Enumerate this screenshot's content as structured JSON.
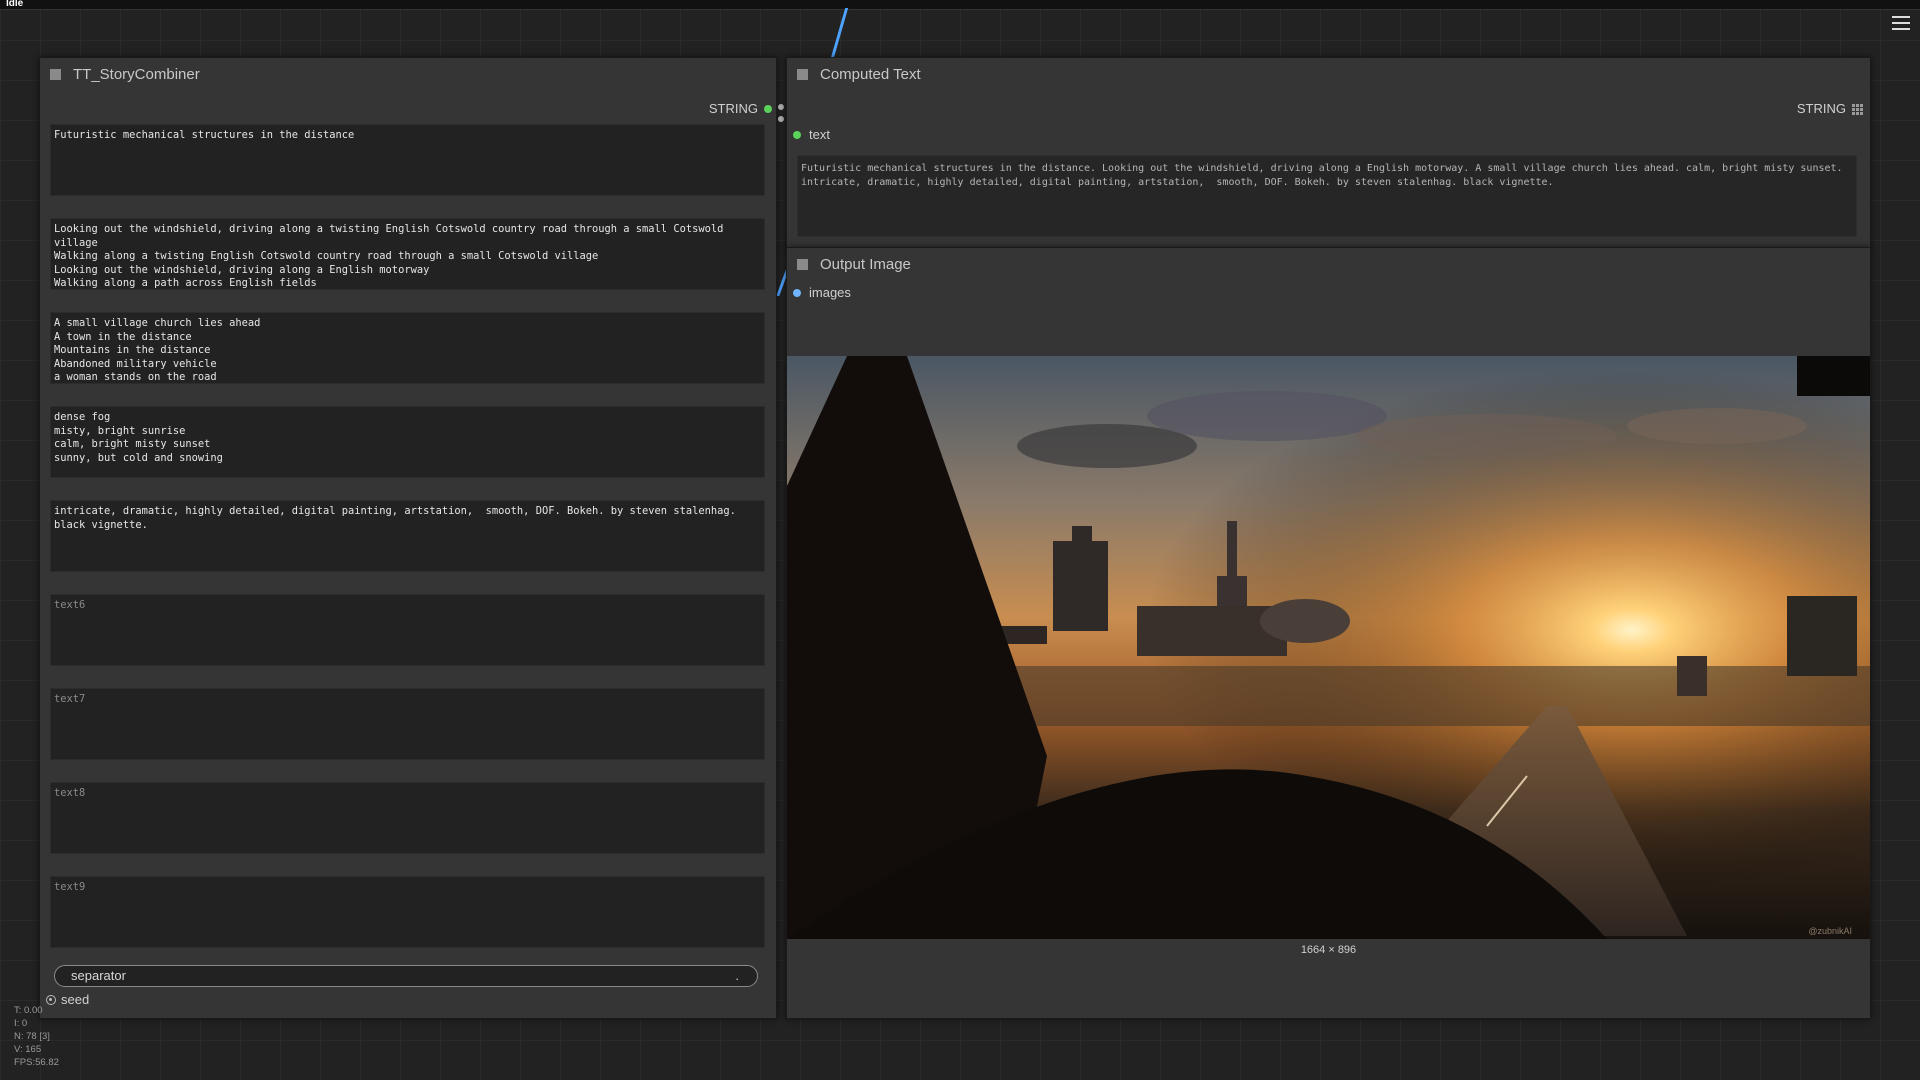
{
  "status": {
    "label": "Idle"
  },
  "story_node": {
    "title": "TT_StoryCombiner",
    "output_label": "STRING",
    "texts": [
      {
        "value": "Futuristic mechanical structures in the distance",
        "placeholder": ""
      },
      {
        "value": "Looking out the windshield, driving along a twisting English Cotswold country road through a small Cotswold village\nWalking along a twisting English Cotswold country road through a small Cotswold village\nLooking out the windshield, driving along a English motorway\nWalking along a path across English fields",
        "placeholder": ""
      },
      {
        "value": "A small village church lies ahead\nA town in the distance\nMountains in the distance\nAbandoned military vehicle\na woman stands on the road",
        "placeholder": ""
      },
      {
        "value": "dense fog\nmisty, bright sunrise\ncalm, bright misty sunset\nsunny, but cold and snowing",
        "placeholder": ""
      },
      {
        "value": "intricate, dramatic, highly detailed, digital painting, artstation,  smooth, DOF. Bokeh. by steven stalenhag. black vignette.",
        "placeholder": ""
      },
      {
        "value": "",
        "placeholder": "text6"
      },
      {
        "value": "",
        "placeholder": "text7"
      },
      {
        "value": "",
        "placeholder": "text8"
      },
      {
        "value": "",
        "placeholder": "text9"
      }
    ],
    "separator_label": "separator",
    "separator_value": ".",
    "seed_label": "seed"
  },
  "computed_node": {
    "title": "Computed Text",
    "output_label": "STRING",
    "input_label": "text",
    "text": "Futuristic mechanical structures in the distance. Looking out the windshield, driving along a English motorway. A small village church lies ahead. calm, bright misty sunset.\nintricate, dramatic, highly detailed, digital painting, artstation,  smooth, DOF. Bokeh. by steven stalenhag. black vignette."
  },
  "output_image_node": {
    "title": "Output Image",
    "input_label": "images",
    "dimensions": "1664 × 896",
    "watermark": "@zubnikAI"
  },
  "stats": [
    "T: 0.00",
    "I: 0",
    "N: 78 [3]",
    "V: 165",
    "FPS:56.82"
  ],
  "colors": {
    "link_wire": "#4da3ff",
    "string_output_dot": "#5ad35a",
    "image_input_dot": "#6fb4ff",
    "node_bg": "#353535",
    "textarea_bg": "#222222"
  }
}
